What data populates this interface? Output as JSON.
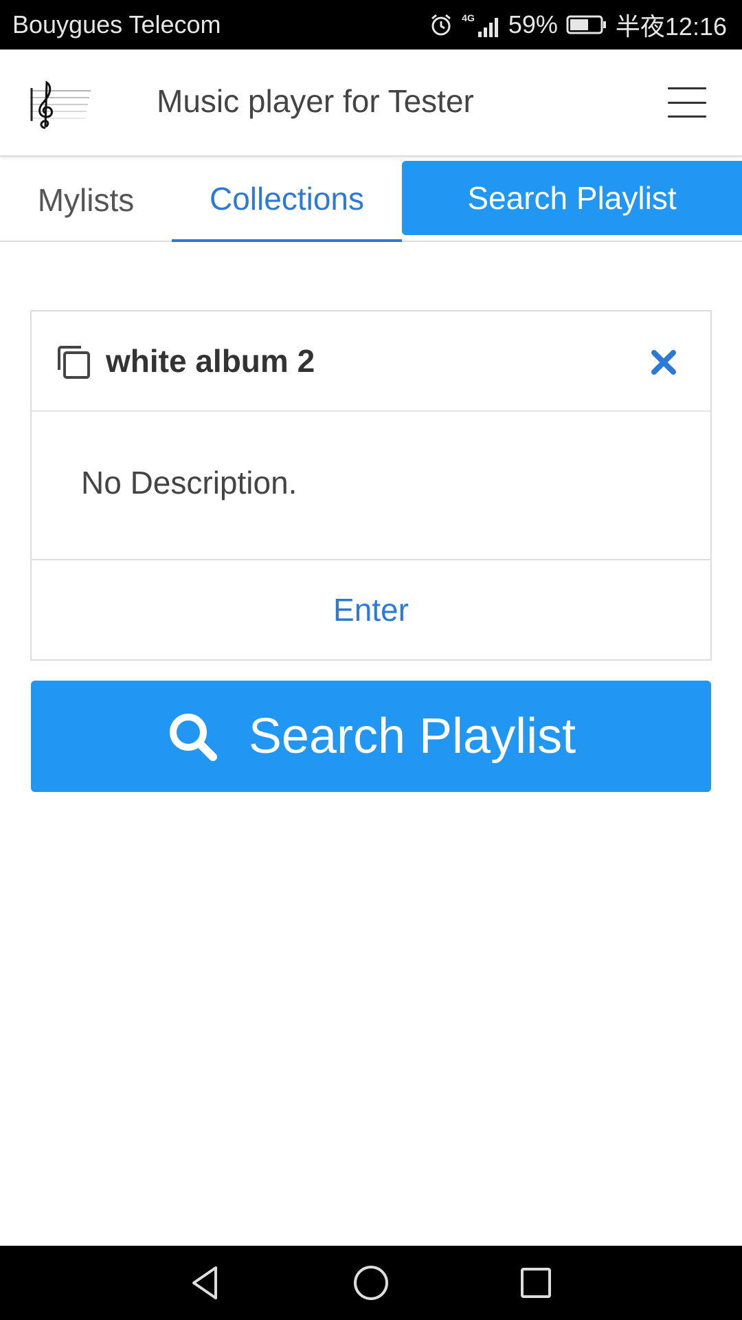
{
  "status_bar": {
    "carrier": "Bouygues Telecom",
    "network": "4G",
    "battery": "59%",
    "time": "半夜12:16",
    "icons": [
      "alarm-icon",
      "signal-icon",
      "battery-icon"
    ]
  },
  "header": {
    "title": "Music player for Tester",
    "logo_icon": "treble-clef-icon",
    "menu_icon": "hamburger-menu-icon"
  },
  "tabs": [
    {
      "label": "Mylists",
      "active": false
    },
    {
      "label": "Collections",
      "active": true
    },
    {
      "label": "Search Playlist",
      "active": false
    }
  ],
  "card": {
    "title": "white album 2",
    "description": "No Description.",
    "action_label": "Enter",
    "icons": [
      "copy-icon",
      "close-icon"
    ]
  },
  "search_button": {
    "label": "Search Playlist",
    "icon": "search-icon"
  },
  "colors": {
    "accent": "#2196f3",
    "link": "#2d7ad6",
    "text": "#444444"
  }
}
